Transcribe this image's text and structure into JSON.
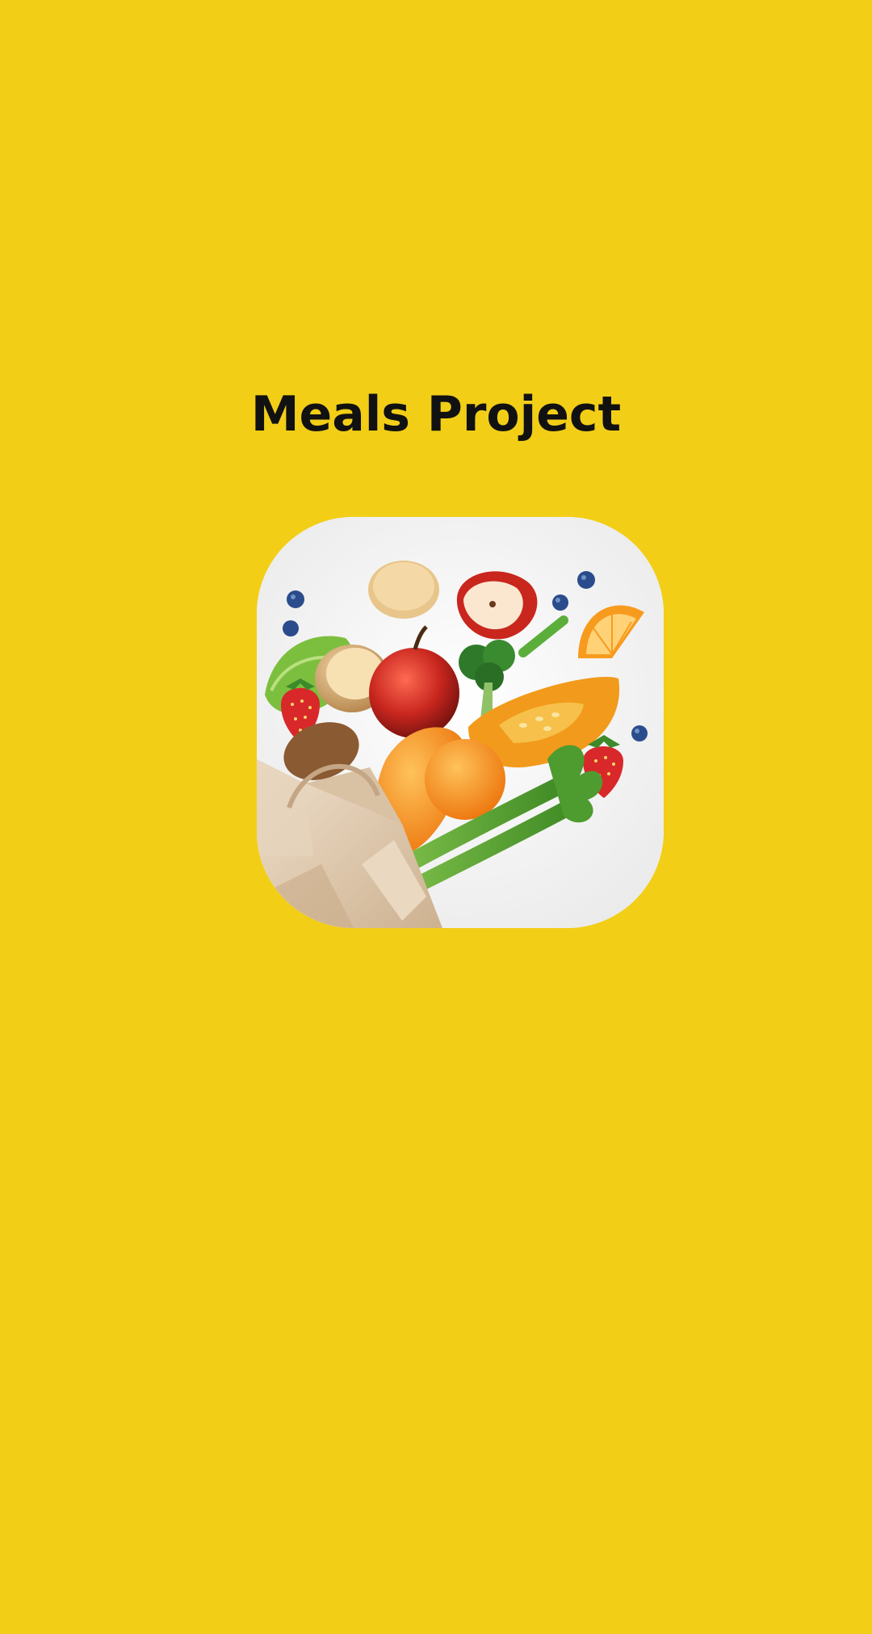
{
  "app": {
    "title": "Meals Project",
    "background_color": "#F2CE17"
  },
  "logo": {
    "icon": "groceries-bag-icon",
    "description_colors": {
      "card": "#F4F4F4",
      "bag": "#DCC3A6",
      "apple": "#C8261E",
      "pumpkin": "#F29A1B",
      "celery": "#4E9B2F",
      "blueberry": "#2B4C8C"
    }
  }
}
